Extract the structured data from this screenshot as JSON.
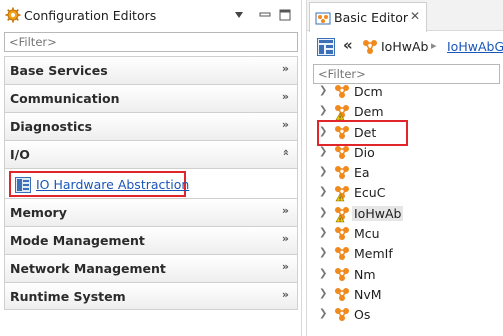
{
  "left_view": {
    "title": "Configuration Editors",
    "filter_placeholder": "<Filter>",
    "sections": [
      {
        "label": "Base Services",
        "expanded": false
      },
      {
        "label": "Communication",
        "expanded": false
      },
      {
        "label": "Diagnostics",
        "expanded": false
      },
      {
        "label": "I/O",
        "expanded": true,
        "items": [
          {
            "label": "IO Hardware Abstraction",
            "highlighted": true
          }
        ]
      },
      {
        "label": "Memory",
        "expanded": false
      },
      {
        "label": "Mode Management",
        "expanded": false
      },
      {
        "label": "Network Management",
        "expanded": false
      },
      {
        "label": "Runtime System",
        "expanded": false
      }
    ]
  },
  "right_view": {
    "tab_title": "Basic Editor",
    "breadcrumb": {
      "current": "IoHwAb",
      "next": "IoHwAbG"
    },
    "filter_placeholder": "<Filter>",
    "tree": [
      {
        "label": "Dcm",
        "warning": false
      },
      {
        "label": "Dem",
        "warning": true
      },
      {
        "label": "Det",
        "warning": false
      },
      {
        "label": "Dio",
        "warning": false
      },
      {
        "label": "Ea",
        "warning": false
      },
      {
        "label": "EcuC",
        "warning": true
      },
      {
        "label": "IoHwAb",
        "warning": true,
        "selected": true,
        "highlighted": true
      },
      {
        "label": "Mcu",
        "warning": false
      },
      {
        "label": "MemIf",
        "warning": false
      },
      {
        "label": "Nm",
        "warning": false
      },
      {
        "label": "NvM",
        "warning": false
      },
      {
        "label": "Os",
        "warning": false
      }
    ]
  },
  "colors": {
    "highlight_border": "#e0262b",
    "link": "#1a56b8",
    "module_icon": "#f08a1d"
  }
}
